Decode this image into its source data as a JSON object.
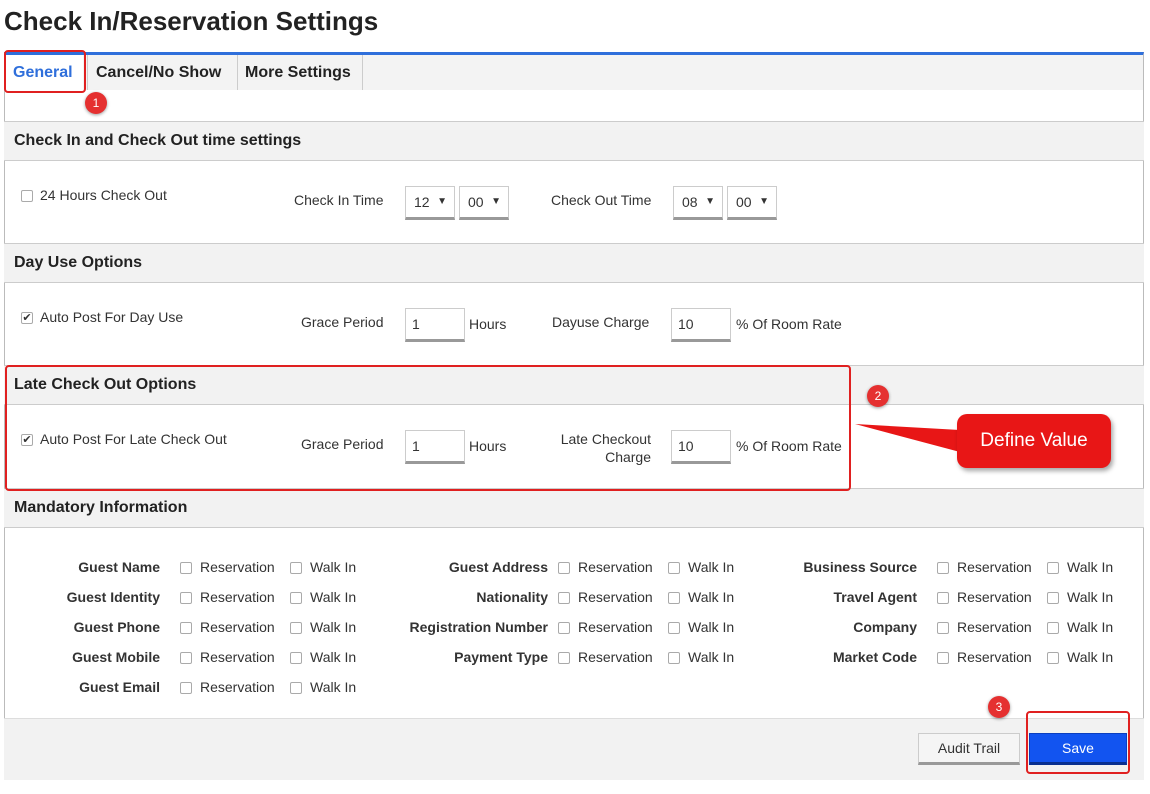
{
  "page": {
    "title": "Check In/Reservation Settings"
  },
  "tabs": [
    {
      "label": "General"
    },
    {
      "label": "Cancel/No Show"
    },
    {
      "label": "More Settings"
    }
  ],
  "checkin_section": {
    "title": "Check In and Check Out time settings",
    "hours24_label": "24 Hours Check Out",
    "hours24_checked": false,
    "checkin_label": "Check In Time",
    "checkin_hour": "12",
    "checkin_min": "00",
    "checkout_label": "Check Out Time",
    "checkout_hour": "08",
    "checkout_min": "00"
  },
  "dayuse_section": {
    "title": "Day Use Options",
    "autopost_label": "Auto Post For Day Use",
    "autopost_checked": true,
    "grace_label": "Grace Period",
    "grace_value": "1",
    "hours_unit": "Hours",
    "charge_label": "Dayuse Charge",
    "charge_value": "10",
    "charge_unit": "% Of Room Rate"
  },
  "late_section": {
    "title": "Late Check Out Options",
    "autopost_label": "Auto Post For Late Check Out",
    "autopost_checked": true,
    "grace_label": "Grace Period",
    "grace_value": "1",
    "hours_unit": "Hours",
    "charge_label_line1": "Late Checkout",
    "charge_label_line2": "Charge",
    "charge_value": "10",
    "charge_unit": "% Of Room Rate"
  },
  "mandatory_section": {
    "title": "Mandatory Information",
    "opt_reservation": "Reservation",
    "opt_walkin": "Walk In",
    "col1": [
      "Guest Name",
      "Guest Identity",
      "Guest Phone",
      "Guest Mobile",
      "Guest Email"
    ],
    "col2": [
      "Guest Address",
      "Nationality",
      "Registration Number",
      "Payment Type"
    ],
    "col3": [
      "Business Source",
      "Travel Agent",
      "Company",
      "Market Code"
    ]
  },
  "footer": {
    "audit_label": "Audit Trail",
    "save_label": "Save"
  },
  "annotations": {
    "badge1": "1",
    "badge2": "2",
    "badge3": "3",
    "callout": "Define Value"
  },
  "colors": {
    "accent": "#2f6fdb",
    "save_button": "#1254f0",
    "annotation_red": "#e02020"
  },
  "icons": {
    "checkbox_checked": "check-mark",
    "select_arrow": "triangle-down"
  }
}
